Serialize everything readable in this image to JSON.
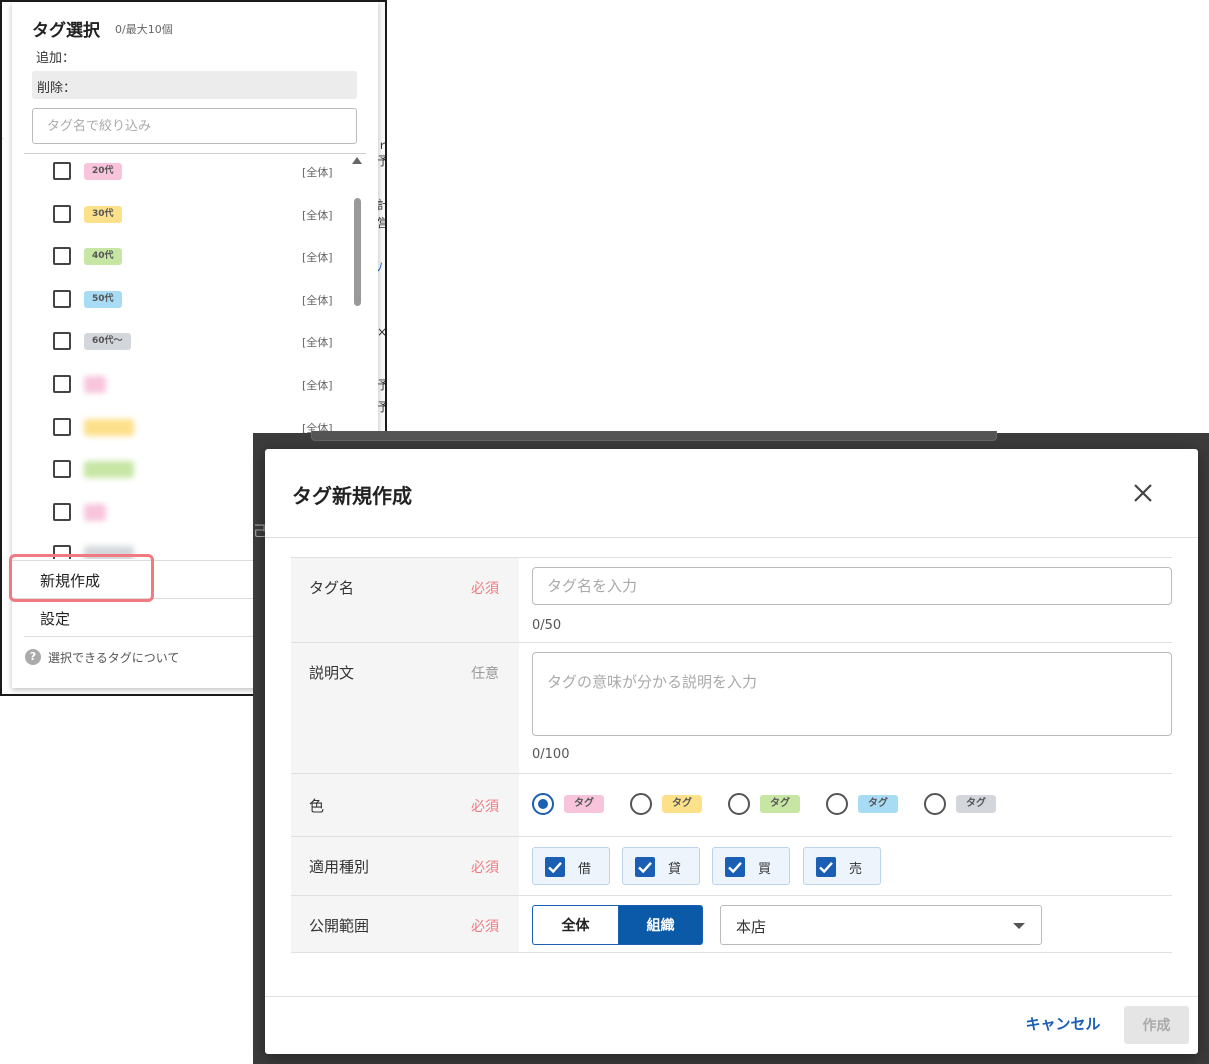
{
  "popover": {
    "title": "タグ選択",
    "count": "0/最大10個",
    "add_label": "追加：",
    "remove_label": "削除：",
    "filter_placeholder": "タグ名で絞り込み",
    "tags": [
      {
        "label": "20代",
        "scope": "[全体]",
        "color": "#f8c4dc",
        "blurred": false
      },
      {
        "label": "30代",
        "scope": "[全体]",
        "color": "#fde08a",
        "blurred": false
      },
      {
        "label": "40代",
        "scope": "[全体]",
        "color": "#c7e6a4",
        "blurred": false
      },
      {
        "label": "50代",
        "scope": "[全体]",
        "color": "#a8dcf5",
        "blurred": false
      },
      {
        "label": "60代〜",
        "scope": "[全体]",
        "color": "#d3d7db",
        "blurred": false
      },
      {
        "label": "",
        "scope": "[全体]",
        "color": "#f8c4dc",
        "blurred": true
      },
      {
        "label": "",
        "scope": "[全体]",
        "color": "#fde08a",
        "blurred": true
      },
      {
        "label": "",
        "scope": "",
        "color": "#c7e6a4",
        "blurred": true
      },
      {
        "label": "",
        "scope": "",
        "color": "#f8c4dc",
        "blurred": true
      },
      {
        "label": "",
        "scope": "",
        "color": "#d3d7db",
        "blurred": true
      }
    ],
    "create_label": "新規作成",
    "settings_label": "設定",
    "help_text": "選択できるタグについて",
    "help_icon_glyph": "?"
  },
  "modal": {
    "title": "タグ新規作成",
    "required_label": "必須",
    "optional_label": "任意",
    "name": {
      "label": "タグ名",
      "placeholder": "タグ名を入力",
      "counter": "0/50"
    },
    "description": {
      "label": "説明文",
      "placeholder": "タグの意味が分かる説明を入力",
      "counter": "0/100"
    },
    "color": {
      "label": "色",
      "selected_index": 0,
      "options": [
        {
          "chip": "タグ",
          "color": "#f8c4dc"
        },
        {
          "chip": "タグ",
          "color": "#fde08a"
        },
        {
          "chip": "タグ",
          "color": "#c7e6a4"
        },
        {
          "chip": "タグ",
          "color": "#a8dcf5"
        },
        {
          "chip": "タグ",
          "color": "#d3d7db"
        }
      ]
    },
    "types": {
      "label": "適用種別",
      "options": [
        {
          "label": "借",
          "checked": true
        },
        {
          "label": "貸",
          "checked": true
        },
        {
          "label": "買",
          "checked": true
        },
        {
          "label": "売",
          "checked": true
        }
      ]
    },
    "scope": {
      "label": "公開範囲",
      "all_label": "全体",
      "org_label": "組織",
      "selected": "組織",
      "branch_value": "本店"
    },
    "cancel_label": "キャンセル",
    "submit_label": "作成",
    "submit_disabled": true
  },
  "colors": {
    "accent": "#1a5fb4",
    "required": "#f07a7f",
    "highlight": "#f07a7f",
    "overlay": "#3c3c3c"
  }
}
